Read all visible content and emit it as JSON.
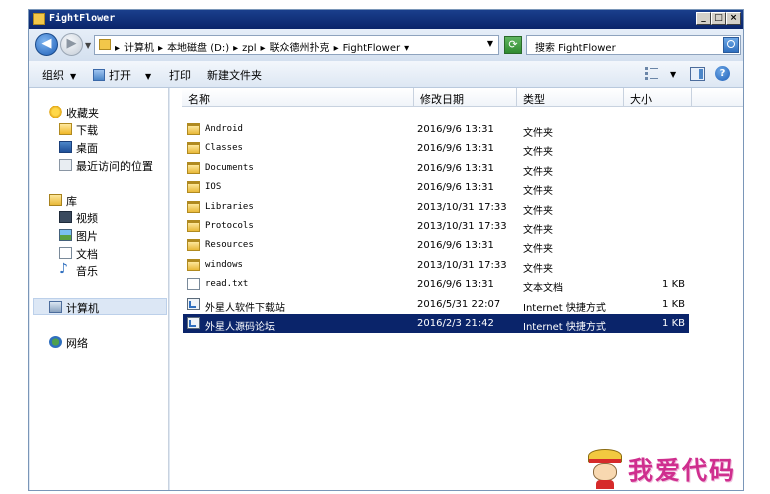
{
  "window": {
    "title": "FightFlower"
  },
  "address": {
    "crumbs": [
      "计算机",
      "本地磁盘 (D:)",
      "zpl",
      "联众德州扑克",
      "FightFlower"
    ]
  },
  "search": {
    "placeholder": "搜索 FightFlower"
  },
  "toolbar": {
    "organize": "组织",
    "open": "打开",
    "print": "打印",
    "new_folder": "新建文件夹"
  },
  "sidebar": {
    "favorites": "收藏夹",
    "fav_items": [
      "下载",
      "桌面",
      "最近访问的位置"
    ],
    "libraries": "库",
    "lib_items": [
      "视频",
      "图片",
      "文档",
      "音乐"
    ],
    "computer": "计算机",
    "network": "网络"
  },
  "columns": {
    "name": "名称",
    "date": "修改日期",
    "type": "类型",
    "size": "大小"
  },
  "files": [
    {
      "name": "Android",
      "date": "2016/9/6 13:31",
      "type": "文件夹",
      "size": "",
      "icon": "folder-icon"
    },
    {
      "name": "Classes",
      "date": "2016/9/6 13:31",
      "type": "文件夹",
      "size": "",
      "icon": "folder-icon"
    },
    {
      "name": "Documents",
      "date": "2016/9/6 13:31",
      "type": "文件夹",
      "size": "",
      "icon": "folder-icon"
    },
    {
      "name": "IOS",
      "date": "2016/9/6 13:31",
      "type": "文件夹",
      "size": "",
      "icon": "folder-icon"
    },
    {
      "name": "Libraries",
      "date": "2013/10/31 17:33",
      "type": "文件夹",
      "size": "",
      "icon": "folder-icon"
    },
    {
      "name": "Protocols",
      "date": "2013/10/31 17:33",
      "type": "文件夹",
      "size": "",
      "icon": "folder-icon"
    },
    {
      "name": "Resources",
      "date": "2016/9/6 13:31",
      "type": "文件夹",
      "size": "",
      "icon": "folder-icon"
    },
    {
      "name": "windows",
      "date": "2013/10/31 17:33",
      "type": "文件夹",
      "size": "",
      "icon": "folder-icon"
    },
    {
      "name": "read.txt",
      "date": "2016/9/6 13:31",
      "type": "文本文档",
      "size": "1 KB",
      "icon": "text-file-icon"
    },
    {
      "name": "外星人软件下载站",
      "date": "2016/5/31 22:07",
      "type": "Internet 快捷方式",
      "size": "1 KB",
      "icon": "shortcut-icon"
    },
    {
      "name": "外星人源码论坛",
      "date": "2016/2/3 21:42",
      "type": "Internet 快捷方式",
      "size": "1 KB",
      "icon": "shortcut-icon"
    }
  ],
  "watermark": {
    "text": "我爱代码"
  }
}
